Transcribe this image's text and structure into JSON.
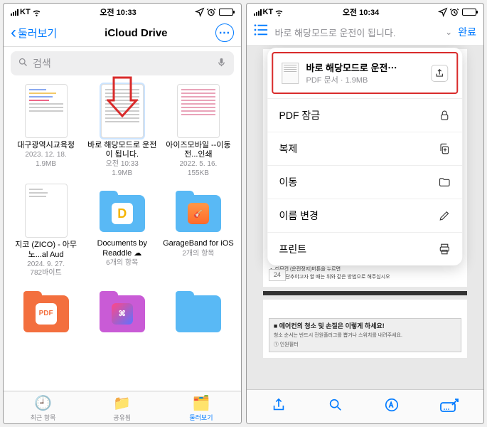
{
  "left": {
    "status": {
      "carrier": "KT",
      "time": "오전 10:33"
    },
    "nav": {
      "back": "둘러보기",
      "title": "iCloud Drive"
    },
    "search": {
      "placeholder": "검색"
    },
    "files": [
      {
        "name": "대구광역시교육청",
        "date": "2023. 12. 18.",
        "size": "1.9MB",
        "kind": "doc-colored"
      },
      {
        "name": "바로 해당모드로 운전이 됩니다.",
        "date": "오전 10:33",
        "size": "1.9MB",
        "kind": "doc-text",
        "selected": true
      },
      {
        "name": "아이즈모바일 --이동전...인쇄",
        "date": "2022. 5. 16.",
        "size": "155KB",
        "kind": "doc-pink"
      },
      {
        "name": "지코 (ZICO) - 아무노...al Aud",
        "date": "2024. 9. 27.",
        "size": "782바이트",
        "kind": "doc-plain"
      },
      {
        "name": "Documents by Readdle ☁︎",
        "date": "6개의 항목",
        "size": "",
        "kind": "folder-docs"
      },
      {
        "name": "GarageBand for iOS",
        "date": "2개의 항목",
        "size": "",
        "kind": "folder-gb"
      }
    ],
    "bottom_folders": {
      "pdf": "PDF",
      "shortcuts": ""
    },
    "tabs": {
      "recent": "최근 항목",
      "shared": "공유됨",
      "browse": "둘러보기"
    }
  },
  "right": {
    "status": {
      "carrier": "KT",
      "time": "오전 10:34"
    },
    "header": {
      "title": "바로 해당모드로 운전이 됩니다.",
      "done": "완료"
    },
    "popover": {
      "name": "바로 해당모드로 운전⋯",
      "meta": "PDF 문서 · 1.9MB",
      "menu": [
        {
          "label": "PDF 잠금",
          "icon": "lock"
        },
        {
          "label": "복제",
          "icon": "duplicate"
        },
        {
          "label": "이동",
          "icon": "folder"
        },
        {
          "label": "이름 변경",
          "icon": "pencil"
        },
        {
          "label": "프린트",
          "icon": "print"
        }
      ]
    },
    "page_body": {
      "page_num": "24",
      "bottom_heading": "■ 에어컨의 청소 및 손질은 이렇게 하세요!",
      "bottom_sub": "청소 순서는 반드시 전원플러그를 뽑거나 스위치를 내려주세요."
    }
  }
}
